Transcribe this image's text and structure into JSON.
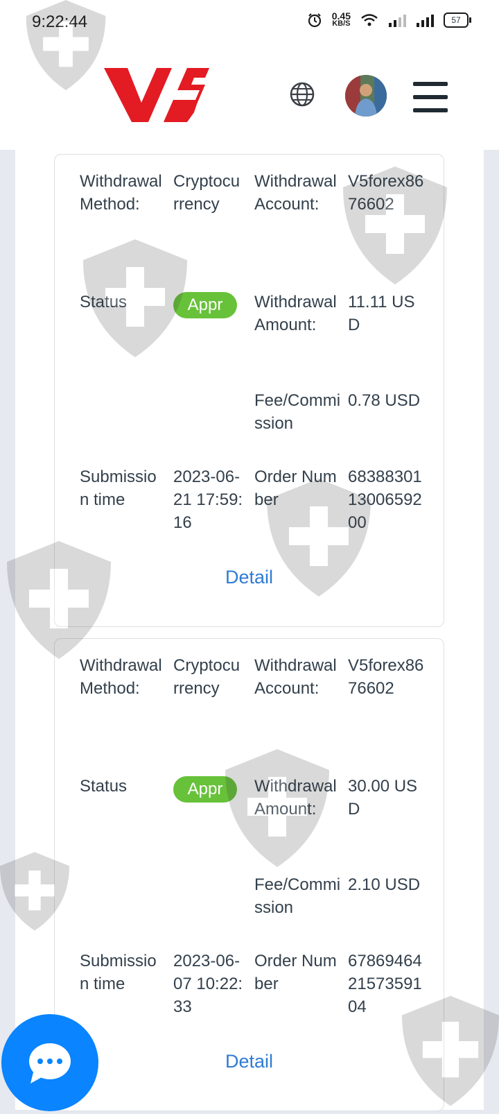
{
  "status_bar": {
    "time": "9:22:44",
    "net_speed_value": "0.45",
    "net_speed_unit": "KB/S",
    "battery": "57"
  },
  "header": {
    "logo_text": "V5",
    "brand_color": "#e31b23"
  },
  "records": [
    {
      "method_label": "Withdrawal Method:",
      "method_value": "Cryptocurrency",
      "account_label": "Withdrawal Account:",
      "account_value": "V5forex8676602",
      "status_label": "Status",
      "status_value": "Appr",
      "amount_label": "Withdrawal Amount:",
      "amount_value": "11.11 USD",
      "fee_label": "Fee/Commission",
      "fee_value": "0.78 USD",
      "time_label": "Submission time",
      "time_value": "2023-06-21 17:59:16",
      "order_label": "Order Number",
      "order_value": "683883011300659200",
      "detail_label": "Detail"
    },
    {
      "method_label": "Withdrawal Method:",
      "method_value": "Cryptocurrency",
      "account_label": "Withdrawal Account:",
      "account_value": "V5forex8676602",
      "status_label": "Status",
      "status_value": "Appr",
      "amount_label": "Withdrawal Amount:",
      "amount_value": "30.00 USD",
      "fee_label": "Fee/Commission",
      "fee_value": "2.10 USD",
      "time_label": "Submission time",
      "time_value": "2023-06-07 10:22:33",
      "order_label": "Order Number",
      "order_value": "678694642157359104",
      "detail_label": "Detail"
    }
  ],
  "colors": {
    "status_approved": "#67c23a",
    "link": "#2f7bd4",
    "chat": "#0a84ff"
  },
  "icons": [
    "alarm-icon",
    "wifi-icon",
    "signal-icon",
    "battery-icon",
    "globe-icon",
    "avatar",
    "hamburger-menu-icon",
    "chat-icon"
  ]
}
